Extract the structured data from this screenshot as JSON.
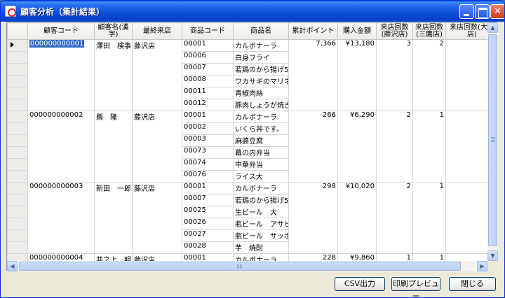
{
  "window": {
    "title": "顧客分析（集計結果）"
  },
  "grid": {
    "columns": [
      {
        "label": "顧客コード"
      },
      {
        "label": "顧客名(漢字)"
      },
      {
        "label": "最終来店"
      },
      {
        "label": "商品コード"
      },
      {
        "label": "商品名"
      },
      {
        "label": "累計ポイント"
      },
      {
        "label": "購入金額"
      },
      {
        "label": "来店回数(藤沢店)"
      },
      {
        "label": "来店回数(三鷹店)"
      },
      {
        "label": "来店回数(大阪店)"
      }
    ],
    "customers": [
      {
        "code": "000000000001",
        "name": "澤田　検事",
        "last_store": "藤沢店",
        "points": "7,366",
        "amount": "¥13,180",
        "visits_fujisawa": "3",
        "visits_mitaka": "2",
        "items": [
          {
            "code": "00001",
            "name": "カルボナーラ"
          },
          {
            "code": "00006",
            "name": "白身フライ"
          },
          {
            "code": "00007",
            "name": "若鶏のから揚げ5"
          },
          {
            "code": "00008",
            "name": "ワカサギのマリネ"
          },
          {
            "code": "00011",
            "name": "青椒肉絲"
          },
          {
            "code": "00012",
            "name": "豚肉しょうが焼き"
          }
        ]
      },
      {
        "code": "000000000002",
        "name": "縣　隆",
        "last_store": "藤沢店",
        "points": "266",
        "amount": "¥6,290",
        "visits_fujisawa": "2",
        "visits_mitaka": "1",
        "items": [
          {
            "code": "00001",
            "name": "カルボナーラ"
          },
          {
            "code": "00002",
            "name": "いくら丼です。"
          },
          {
            "code": "00003",
            "name": "麻婆豆腐"
          },
          {
            "code": "00073",
            "name": "幕の内弁当"
          },
          {
            "code": "00074",
            "name": "中華弁当"
          },
          {
            "code": "00076",
            "name": "ライス大"
          }
        ]
      },
      {
        "code": "000000000003",
        "name": "新田　一郎...",
        "last_store": "藤沢店",
        "points": "298",
        "amount": "¥10,020",
        "visits_fujisawa": "2",
        "visits_mitaka": "1",
        "items": [
          {
            "code": "00001",
            "name": "カルボナーラ"
          },
          {
            "code": "00007",
            "name": "若鶏のから揚げ5"
          },
          {
            "code": "00025",
            "name": "生ビール　大"
          },
          {
            "code": "00026",
            "name": "瓶ビール　アサヒ"
          },
          {
            "code": "00027",
            "name": "瓶ビール　サッポロ"
          },
          {
            "code": "00028",
            "name": "芋　焼酎"
          }
        ]
      },
      {
        "code": "000000000004",
        "name": "井之上　明...",
        "last_store": "藤沢店",
        "points": "228",
        "amount": "¥9,860",
        "visits_fujisawa": "1",
        "visits_mitaka": "1",
        "items": [
          {
            "code": "00001",
            "name": "カルボナーラ"
          }
        ]
      }
    ]
  },
  "buttons": {
    "csv": "CSV出力",
    "print_preview": "印刷プレビュー",
    "close": "閉じる"
  },
  "scroll": {
    "up": "▲",
    "down": "▼",
    "left": "◀",
    "right": "▶"
  }
}
